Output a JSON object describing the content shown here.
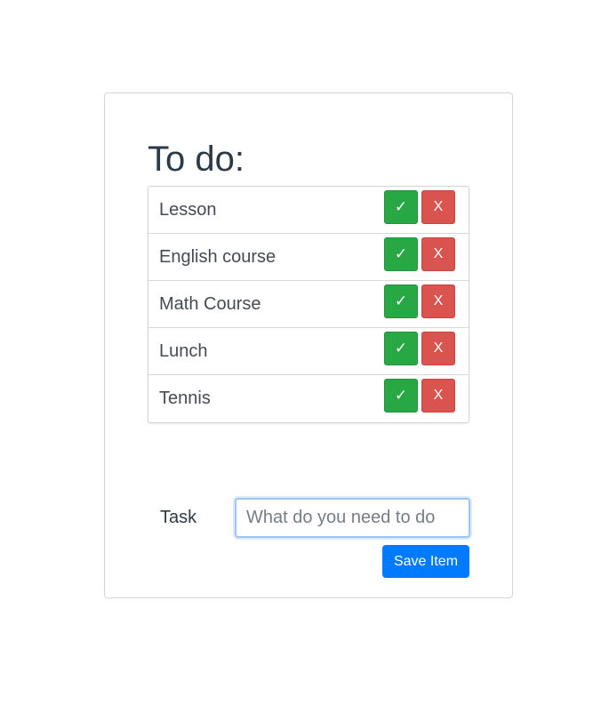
{
  "title": "To do:",
  "items": [
    {
      "label": "Lesson",
      "complete_icon": "✓",
      "delete_icon": "X"
    },
    {
      "label": "English course",
      "complete_icon": "✓",
      "delete_icon": "X"
    },
    {
      "label": "Math Course",
      "complete_icon": "✓",
      "delete_icon": "X"
    },
    {
      "label": "Lunch",
      "complete_icon": "✓",
      "delete_icon": "X"
    },
    {
      "label": "Tennis",
      "complete_icon": "✓",
      "delete_icon": "X"
    }
  ],
  "form": {
    "task_label": "Task",
    "task_placeholder": "What do you need to do",
    "task_value": "",
    "save_label": "Save Item"
  },
  "colors": {
    "complete": "#28a745",
    "delete": "#d9534f",
    "primary": "#007bff"
  }
}
